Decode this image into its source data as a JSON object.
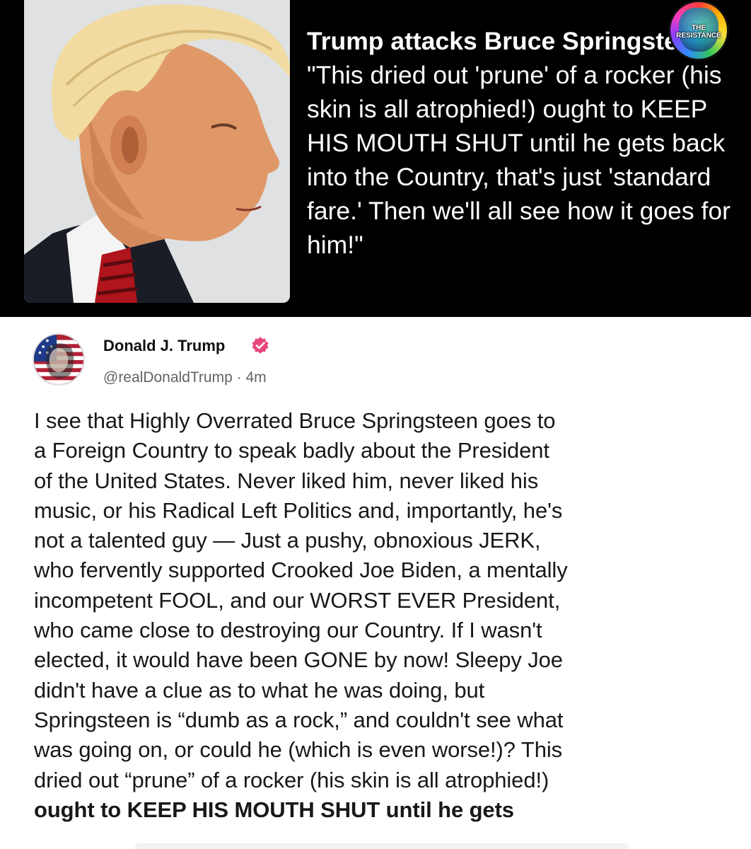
{
  "headline": {
    "bold": "Trump attacks Bruce Springsteen:",
    "text": " \"This dried out 'prune' of a rocker (his skin is all atrophied!) ought to KEEP HIS MOUTH SHUT until he gets back into the Country, that's just 'standard fare.' Then we'll all see how it goes for him!\""
  },
  "badge": {
    "line1": "THE",
    "line2": "RESISTANCE"
  },
  "post": {
    "author": "Donald J. Trump",
    "handle": "@realDonaldTrump · 4m",
    "lines": [
      "I see that Highly Overrated Bruce Springsteen goes to",
      "a Foreign Country to speak badly about the President",
      "of the United States. Never liked him, never liked his",
      "music, or his Radical Left Politics and, importantly, he's",
      "not a talented guy — Just a pushy, obnoxious JERK,",
      "who fervently supported Crooked Joe Biden, a mentally",
      "incompetent FOOL, and our WORST EVER President,",
      "who came close to destroying our Country. If I wasn't",
      "elected, it would have been GONE by now! Sleepy Joe",
      "didn't have a clue as to what he was doing, but",
      "Springsteen is “dumb as a rock,” and couldn't see what",
      "was going on, or could he (which is even worse!)? This",
      "dried out “prune” of a rocker (his skin is all atrophied!)"
    ],
    "bold_line": "ought to KEEP HIS MOUTH SHUT until he gets"
  },
  "colors": {
    "banner_bg": "#000000",
    "verified": "#e8467c",
    "post_text": "#16181a",
    "handle": "#5f6468"
  },
  "icons": {
    "photo": "man-profile-photo",
    "badge": "resistance-logo-icon",
    "avatar": "flag-portrait-avatar",
    "verified": "verified-badge-icon"
  }
}
